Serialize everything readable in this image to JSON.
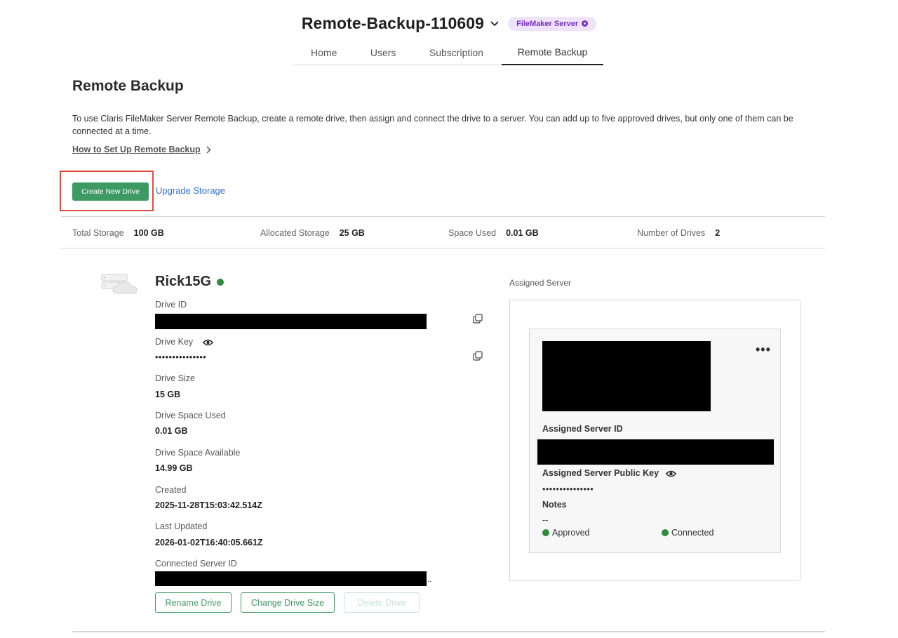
{
  "header": {
    "title": "Remote-Backup-110609",
    "badge": "FileMaker Server",
    "tabs": [
      "Home",
      "Users",
      "Subscription",
      "Remote Backup"
    ],
    "active_tab": "Remote Backup"
  },
  "page": {
    "heading": "Remote Backup",
    "description": "To use Claris FileMaker Server Remote Backup, create a remote drive, then assign and connect the drive to a server. You can add up to five approved drives, but only one of them can be connected at a time.",
    "howto_link": "How to Set Up Remote Backup",
    "create_button": "Create New Drive",
    "upgrade_link": "Upgrade Storage"
  },
  "stats": {
    "total_label": "Total Storage",
    "total_value": "100 GB",
    "allocated_label": "Allocated Storage",
    "allocated_value": "25 GB",
    "used_label": "Space Used",
    "used_value": "0.01 GB",
    "drives_label": "Number of Drives",
    "drives_value": "2"
  },
  "drive": {
    "name": "Rick15G",
    "status_color": "#2e8b3c",
    "drive_id_label": "Drive ID",
    "drive_key_label": "Drive Key",
    "drive_key_value": "•••••••••••••••",
    "size_label": "Drive Size",
    "size_value": "15 GB",
    "space_used_label": "Drive Space Used",
    "space_used_value": "0.01 GB",
    "space_available_label": "Drive Space Available",
    "space_available_value": "14.99 GB",
    "created_label": "Created",
    "created_value": "2025-11-28T15:03:42.514Z",
    "updated_label": "Last Updated",
    "updated_value": "2026-01-02T16:40:05.661Z",
    "connected_server_label": "Connected Server ID",
    "buttons": {
      "rename": "Rename Drive",
      "change_size": "Change Drive Size",
      "delete": "Delete Drive"
    }
  },
  "assigned_server": {
    "title": "Assigned Server",
    "server_id_label": "Assigned Server ID",
    "public_key_label": "Assigned Server Public Key",
    "public_key_value": "•••••••••••••••",
    "notes_label": "Notes",
    "notes_value": "--",
    "approved": "Approved",
    "connected": "Connected"
  },
  "colors": {
    "accent_green": "#3e9a63",
    "link_blue": "#2f6fd1",
    "badge_purple": "#7b2fc0",
    "highlight_red": "#e14b3b"
  }
}
